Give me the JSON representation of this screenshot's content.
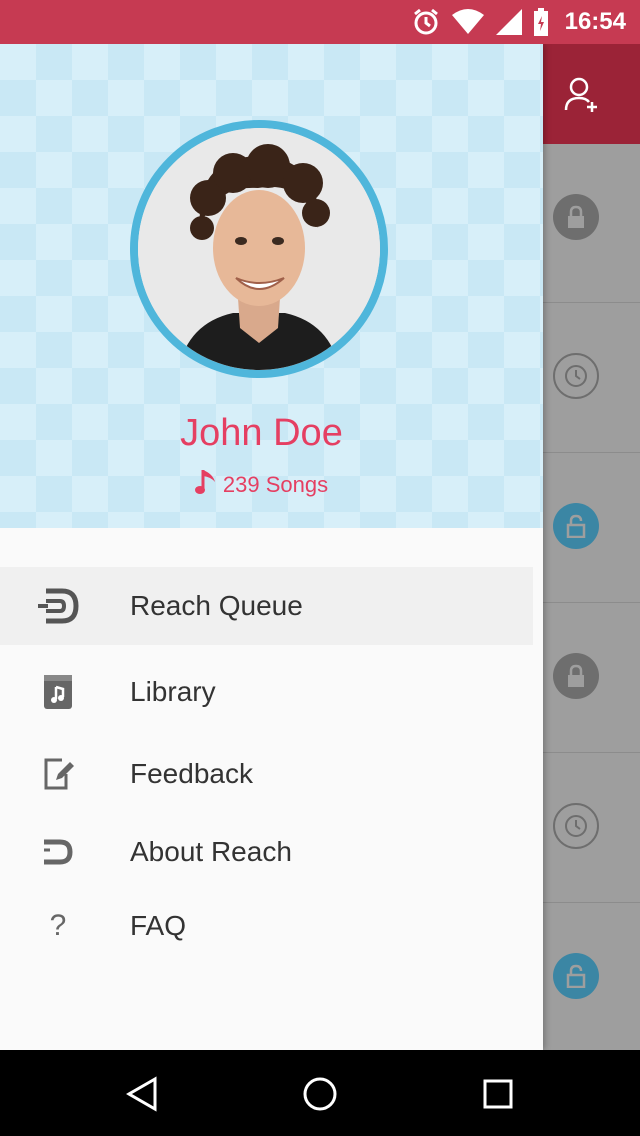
{
  "status_bar": {
    "time": "16:54",
    "icons": [
      "alarm-icon",
      "wifi-icon",
      "signal-icon",
      "battery-icon"
    ]
  },
  "profile": {
    "name": "John Doe",
    "songs_count": "239 Songs",
    "avatar": "profile-photo"
  },
  "menu": {
    "items": [
      {
        "label": "Reach Queue",
        "icon": "reach-queue-icon",
        "active": true
      },
      {
        "label": "Library",
        "icon": "library-icon",
        "active": false
      },
      {
        "label": "Feedback",
        "icon": "feedback-icon",
        "active": false
      },
      {
        "label": "About Reach",
        "icon": "reach-logo-icon",
        "active": false
      },
      {
        "label": "FAQ",
        "icon": "question-icon",
        "active": false
      }
    ]
  },
  "background_screen": {
    "top_action": "add-user-icon",
    "rows": [
      "lock-icon",
      "clock-icon",
      "unlock-icon",
      "lock-icon",
      "clock-icon",
      "unlock-icon"
    ]
  },
  "nav_bar": [
    "back-icon",
    "home-icon",
    "recents-icon"
  ],
  "colors": {
    "status_bar": "#c63a52",
    "accent_pink": "#e53f62",
    "avatar_ring": "#4fb6db",
    "header_bg": "#d7eff9"
  },
  "faq_glyph": "?"
}
